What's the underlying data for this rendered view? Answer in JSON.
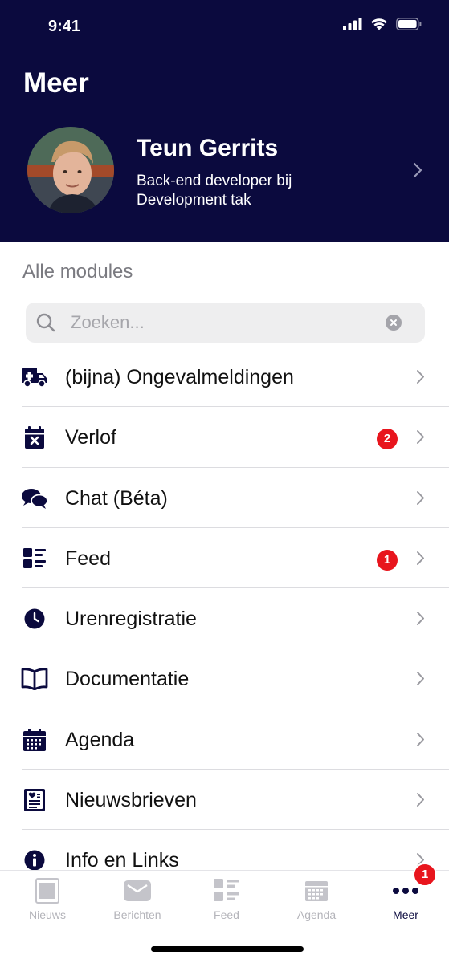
{
  "status_bar": {
    "time": "9:41"
  },
  "header": {
    "title": "Meer",
    "profile": {
      "name": "Teun Gerrits",
      "role": "Back-end developer bij Development tak"
    }
  },
  "modules": {
    "section_title": "Alle modules",
    "search": {
      "placeholder": "Zoeken...",
      "value": ""
    },
    "items": [
      {
        "label": "(bijna) Ongevalmeldingen",
        "icon": "ambulance-icon",
        "badge": null
      },
      {
        "label": "Verlof",
        "icon": "calendar-x-icon",
        "badge": "2"
      },
      {
        "label": "Chat (Béta)",
        "icon": "chat-bubbles-icon",
        "badge": null
      },
      {
        "label": "Feed",
        "icon": "feed-list-icon",
        "badge": "1"
      },
      {
        "label": "Urenregistratie",
        "icon": "clock-icon",
        "badge": null
      },
      {
        "label": "Documentatie",
        "icon": "book-icon",
        "badge": null
      },
      {
        "label": "Agenda",
        "icon": "calendar-icon",
        "badge": null
      },
      {
        "label": "Nieuwsbrieven",
        "icon": "newsletter-icon",
        "badge": null
      },
      {
        "label": "Info en Links",
        "icon": "info-icon",
        "badge": null
      }
    ]
  },
  "tabbar": {
    "tabs": [
      {
        "label": "Nieuws",
        "icon": "news-icon"
      },
      {
        "label": "Berichten",
        "icon": "envelope-icon"
      },
      {
        "label": "Feed",
        "icon": "feed-icon"
      },
      {
        "label": "Agenda",
        "icon": "calendar-icon"
      },
      {
        "label": "Meer",
        "icon": "more-dots-icon",
        "active": true,
        "badge": "1"
      }
    ]
  },
  "colors": {
    "brand_navy": "#0b0a3e",
    "badge_red": "#e8151d",
    "inactive_gray": "#b4b4ba"
  }
}
